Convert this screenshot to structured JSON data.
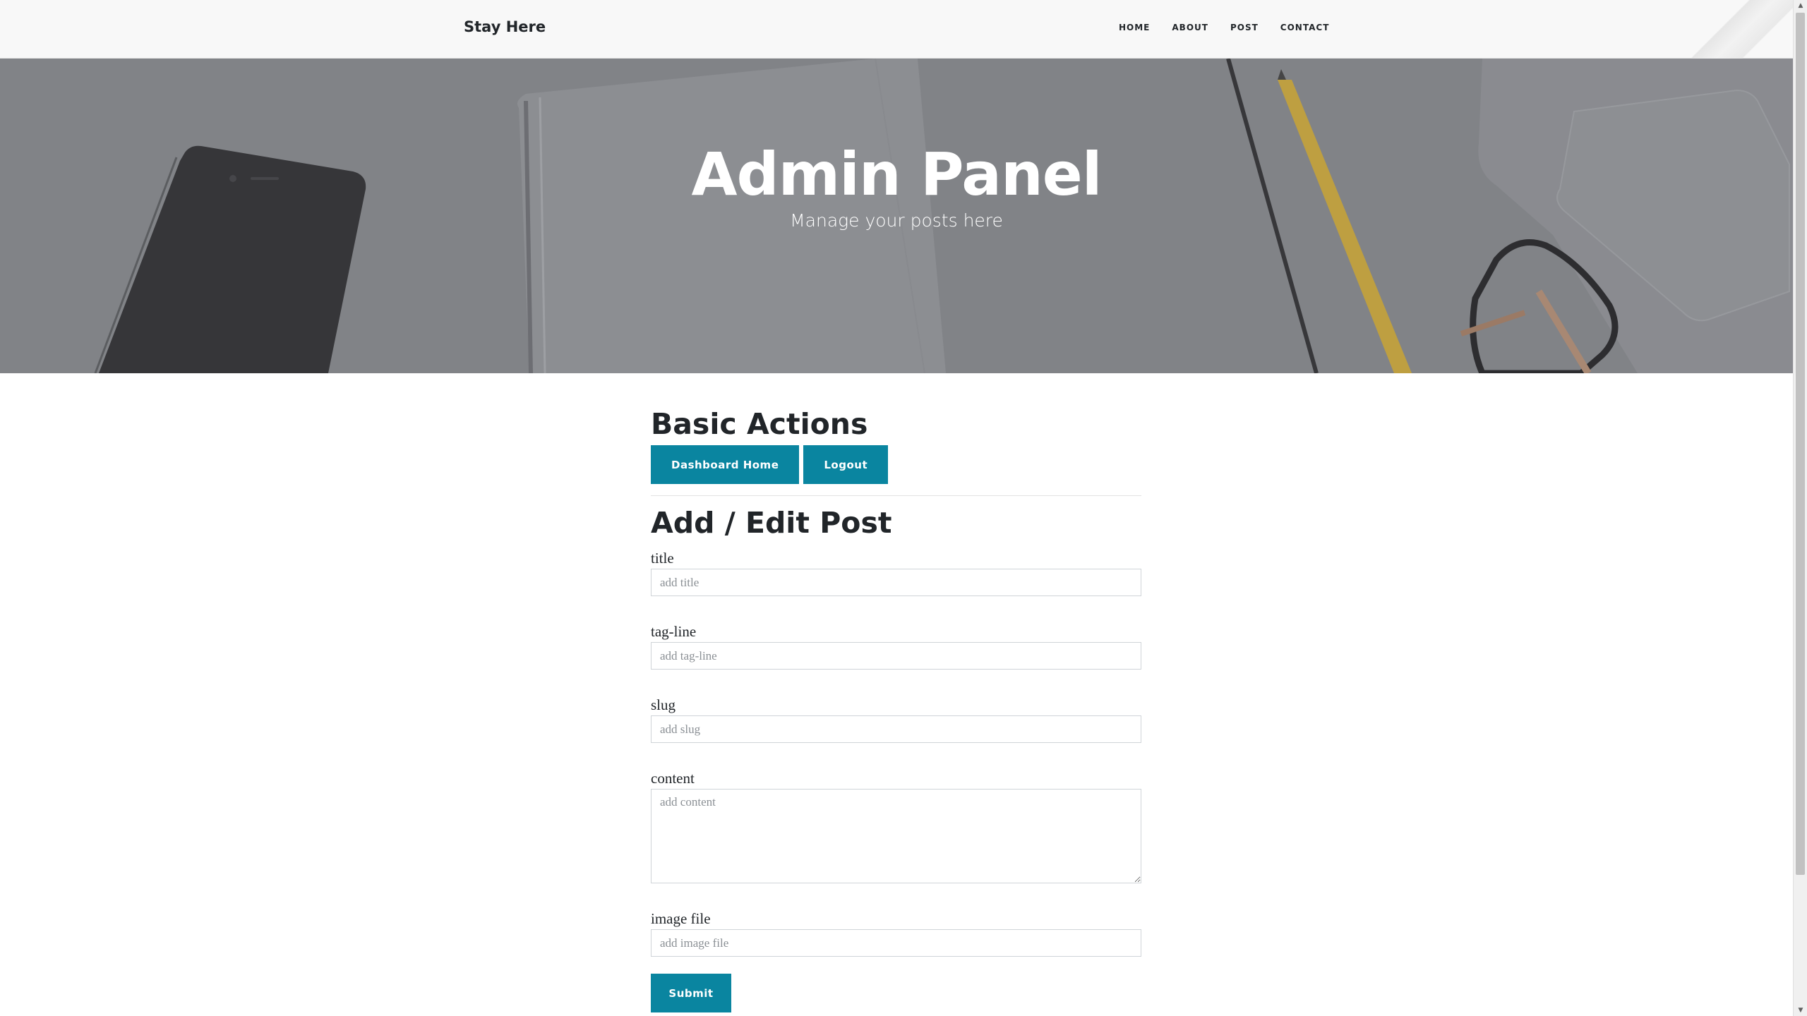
{
  "navbar": {
    "brand": "Stay Here",
    "links": [
      "Home",
      "About",
      "Post",
      "Contact"
    ]
  },
  "header": {
    "title": "Admin Panel",
    "subtitle": "Manage your posts here"
  },
  "basic_actions": {
    "heading": "Basic Actions",
    "buttons": [
      "Dashboard Home",
      "Logout"
    ]
  },
  "edit_post": {
    "heading": "Add / Edit Post",
    "fields": {
      "title": {
        "label": "title",
        "placeholder": "add title"
      },
      "tagline": {
        "label": "tag-line",
        "placeholder": "add tag-line"
      },
      "slug": {
        "label": "slug",
        "placeholder": "add slug"
      },
      "content": {
        "label": "content",
        "placeholder": "add content"
      },
      "image": {
        "label": "image file",
        "placeholder": "add image file"
      }
    },
    "submit_label": "Submit"
  },
  "colors": {
    "accent": "#0a85a0",
    "navbar_bg": "#f8f8f8",
    "hero_overlay": "#808286"
  }
}
